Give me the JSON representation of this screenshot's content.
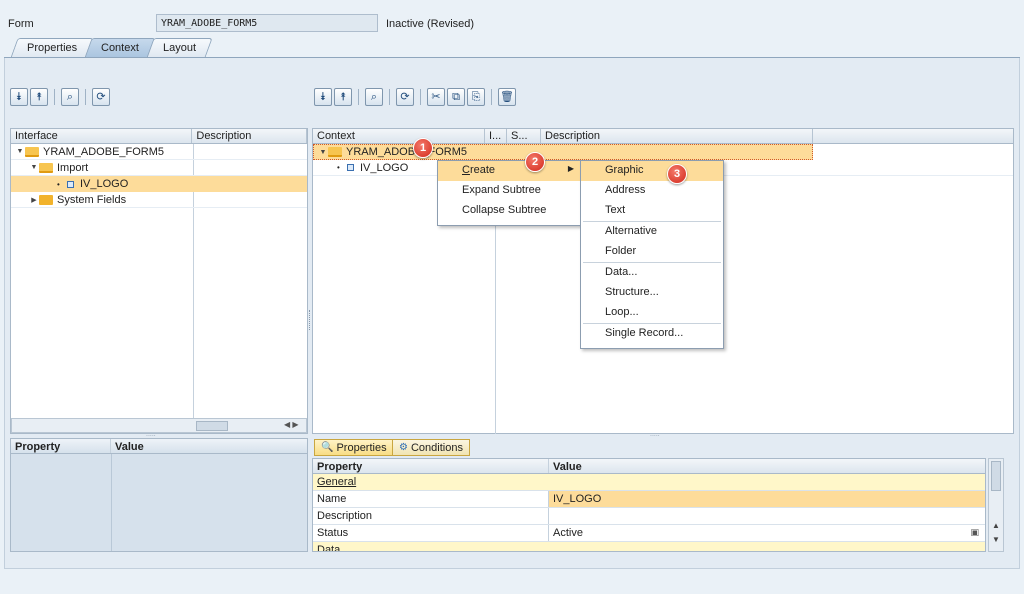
{
  "header": {
    "form_label": "Form",
    "form_name": "YRAM_ADOBE_FORM5",
    "status": "Inactive (Revised)"
  },
  "tabs": [
    {
      "label": "Properties"
    },
    {
      "label": "Context"
    },
    {
      "label": "Layout"
    }
  ],
  "interface_panel": {
    "columns": [
      "Interface",
      "Description"
    ],
    "nodes": [
      "YRAM_ADOBE_FORM5",
      "Import",
      "IV_LOGO",
      "System Fields"
    ]
  },
  "context_panel": {
    "columns": [
      "Context",
      "I...",
      "S...",
      "Description"
    ],
    "nodes": [
      "YRAM_ADOBE_FORM5",
      "IV_LOGO"
    ]
  },
  "context_menu": {
    "items": [
      {
        "label": "Create",
        "mnemonic": "C"
      },
      {
        "label": "Expand Subtree",
        "mnemonic": "E"
      },
      {
        "label": "Collapse Subtree",
        "mnemonic": "o"
      }
    ]
  },
  "create_submenu": {
    "items": [
      "Graphic",
      "Address",
      "Text",
      "Alternative",
      "Folder",
      "Data...",
      "Structure...",
      "Loop...",
      "Single Record..."
    ]
  },
  "badges": [
    "1",
    "2",
    "3"
  ],
  "left_props": {
    "columns": [
      "Property",
      "Value"
    ]
  },
  "right_props": {
    "subtabs": [
      "Properties",
      "Conditions"
    ],
    "columns": [
      "Property",
      "Value"
    ],
    "rows": [
      {
        "property": "General",
        "value": ""
      },
      {
        "property": "Name",
        "value": "IV_LOGO"
      },
      {
        "property": "Description",
        "value": ""
      },
      {
        "property": "Status",
        "value": "Active"
      },
      {
        "property": "Data",
        "value": ""
      }
    ]
  },
  "colors": {
    "highlight": "#fddc9a",
    "badge": "#d2271a",
    "folder": "#f2b32c",
    "tab_active": "#a9c4df"
  }
}
